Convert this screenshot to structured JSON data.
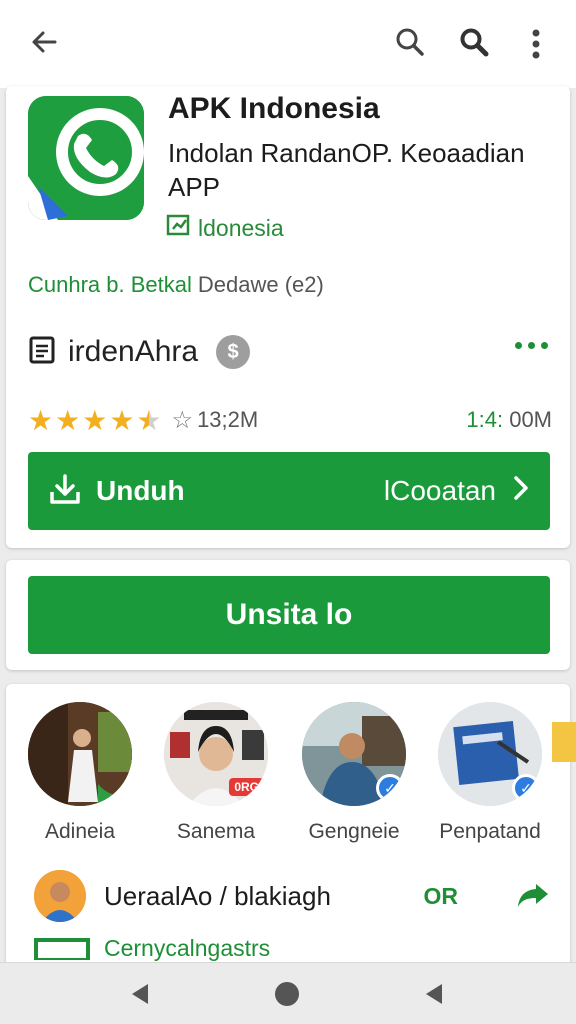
{
  "app": {
    "title": "APK Indonesia",
    "subtitle": "Indolan RandanOP. Keoaadian APP",
    "region": "ldonesia",
    "meta_green": "Cunhra b. Betkal",
    "meta_grey": "Dedawe (e2)",
    "developer": "irdenAhra",
    "developer_badge": "$",
    "rating_value": 4.5,
    "rating_max": 5,
    "reviews": "13;2M",
    "size_accent": "1:4:",
    "size_rest": "00M"
  },
  "buttons": {
    "download_label": "Unduh",
    "download_right": "lCooatan",
    "install_label": "Unsita lo"
  },
  "avatars": [
    {
      "label": "Adineia"
    },
    {
      "label": "Sanema",
      "badge": "0RG"
    },
    {
      "label": "Gengneie"
    },
    {
      "label": "Penpatand"
    }
  ],
  "share": {
    "text": "UeraalAo / blakiagh",
    "code": "OR"
  },
  "category": {
    "text": "Cernycalngastrs"
  },
  "colors": {
    "accent": "#1b9a3b",
    "star": "#f2b01e",
    "verified": "#2d7de0"
  },
  "icons": [
    "back-arrow-icon",
    "search-icon",
    "search-bold-icon",
    "more-vert-icon",
    "app-logo-icon",
    "region-icon",
    "document-icon",
    "more-horiz-icon",
    "download-icon",
    "chevron-right-icon",
    "share-arrow-icon",
    "category-icon",
    "nav-back-icon",
    "nav-home-icon",
    "nav-recent-icon"
  ]
}
